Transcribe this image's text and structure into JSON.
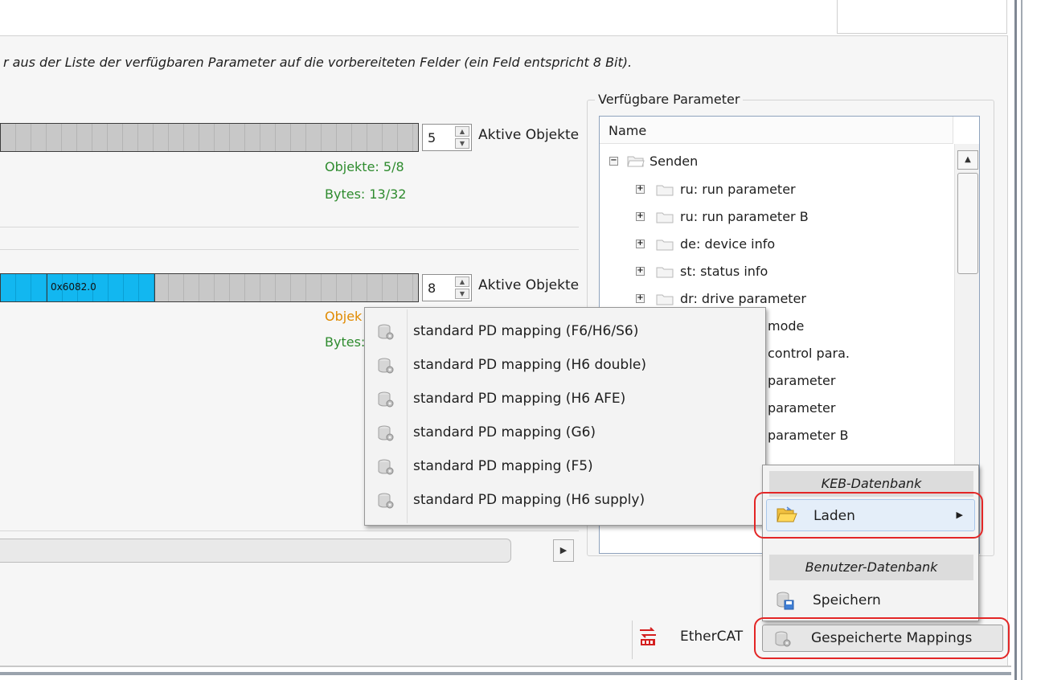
{
  "instruction": "r aus der Liste der verfügbaren Parameter auf die vorbereiteten Felder (ein Feld entspricht 8 Bit).",
  "mapping_top": {
    "active_count": "5",
    "active_label": "Aktive Objekte",
    "objects_text": "Objekte: 5/8",
    "bytes_text": "Bytes: 13/32"
  },
  "mapping_bottom": {
    "segment_label": "0x6082.0",
    "active_count": "8",
    "active_label": "Aktive Objekte",
    "objects_text_partial": "Objek",
    "bytes_text_partial": "Bytes:"
  },
  "available_params": {
    "group_title": "Verfügbare Parameter",
    "column_header": "Name",
    "root": {
      "label": "Senden",
      "expander": "−"
    },
    "items": [
      {
        "label": "ru: run parameter",
        "expander": "+"
      },
      {
        "label": "ru: run parameter B",
        "expander": "+"
      },
      {
        "label": "de: device info",
        "expander": "+"
      },
      {
        "label": "st: status info",
        "expander": "+"
      },
      {
        "label": "dr: drive parameter",
        "expander": "+"
      },
      {
        "label": "mode"
      },
      {
        "label": "control para."
      },
      {
        "label": "parameter"
      },
      {
        "label": "parameter"
      },
      {
        "label": "parameter B"
      }
    ]
  },
  "load_submenu": {
    "items": [
      "standard PD mapping (F6/H6/S6)",
      "standard PD mapping (H6 double)",
      "standard PD mapping (H6 AFE)",
      "standard PD mapping (G6)",
      "standard PD mapping (F5)",
      "standard PD mapping (H6 supply)"
    ]
  },
  "context_menu": {
    "keb_header": "KEB-Datenbank",
    "load_label": "Laden",
    "user_header": "Benutzer-Datenbank",
    "save_label": "Speichern"
  },
  "status_bar": {
    "protocol_label": "EtherCAT",
    "saved_mappings_label": "Gespeicherte Mappings"
  },
  "colors": {
    "mapped_segment": "#12b7f0",
    "free_segment": "#c8c8c8",
    "ok_text": "#2e8b2e",
    "warn_text": "#e08a00",
    "highlight_ring": "#e32626"
  }
}
